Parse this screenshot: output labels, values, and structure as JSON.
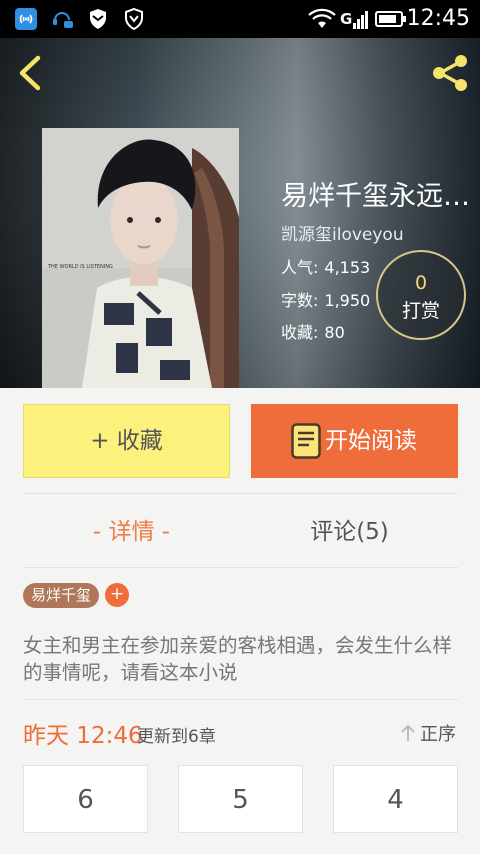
{
  "status_bar": {
    "time": "12:45",
    "network_label": "G",
    "icons": [
      "antenna-icon",
      "headset-chat-icon",
      "shield-icon",
      "shield-check-icon",
      "wifi-icon",
      "signal-icon",
      "battery-icon"
    ]
  },
  "header": {
    "back_icon": "chevron-left-icon",
    "share_icon": "share-icon"
  },
  "book": {
    "title": "易烊千玺永远…",
    "author": "凯源玺iloveyou",
    "stats": {
      "popularity_label": "人气:",
      "popularity_value": "4,153",
      "words_label": "字数:",
      "words_value": "1,950",
      "favorites_label": "收藏:",
      "favorites_value": "80"
    },
    "cover_caption": "THE WORLD IS LISTENING"
  },
  "reward": {
    "count": "0",
    "label": "打赏"
  },
  "actions": {
    "favorite_label": "+ 收藏",
    "read_label": "开始阅读"
  },
  "tabs": {
    "details": "- 详情 -",
    "comments": "评论(5)"
  },
  "tags": [
    "易烊千玺"
  ],
  "tag_add": "+",
  "synopsis": "女主和男主在参加亲爱的客栈相遇，会发生什么样的事情呢，请看这本小说",
  "update": {
    "time": "昨天 12:46",
    "text": "更新到6章",
    "sort_label": "正序"
  },
  "chapters": [
    "6",
    "5",
    "4"
  ],
  "colors": {
    "accent_orange": "#ef6d3b",
    "favorite_yellow": "#fbf17c",
    "icon_yellow": "#f5e36a",
    "tag_brown": "#b0765a"
  }
}
